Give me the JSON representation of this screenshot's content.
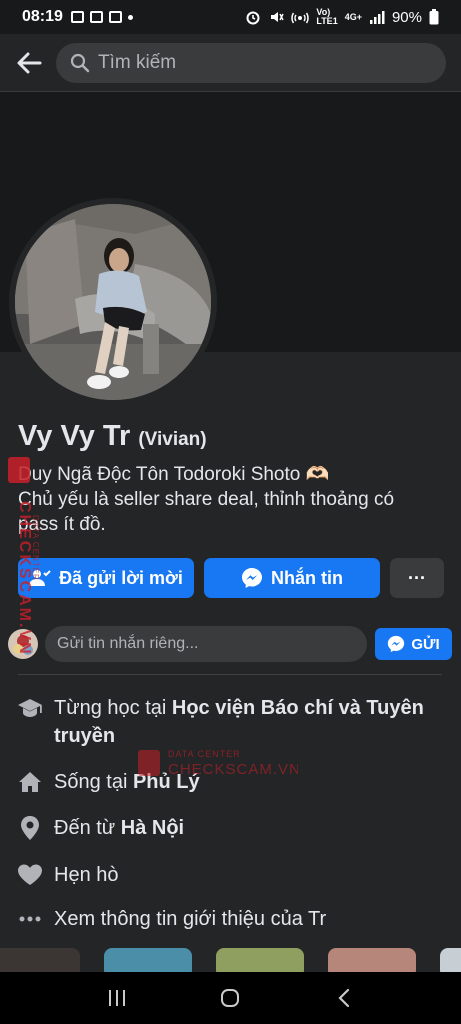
{
  "status": {
    "time": "08:19",
    "network": "4G+",
    "battery": "90%"
  },
  "search": {
    "placeholder": "Tìm kiếm"
  },
  "profile": {
    "name": "Vy Vy Tr",
    "alt_name": "(Vivian)",
    "bio_line1": "Duy Ngã Độc Tôn Todoroki Shoto 🫶🏻",
    "bio_line2": "Chủ yếu là seller share deal, thỉnh thoảng có",
    "bio_line3": "pass ít đồ."
  },
  "actions": {
    "friend_request_label": "Đã gửi lời mời",
    "message_label": "Nhắn tin",
    "more_label": "···"
  },
  "private_message": {
    "placeholder": "Gửi tin nhắn riêng...",
    "send_label": "GỬI"
  },
  "intro": [
    {
      "icon": "graduation-cap-icon",
      "prefix": "Từng học tại ",
      "bold": "Học viện Báo chí và Tuyên truyền"
    },
    {
      "icon": "home-icon",
      "prefix": "Sống tại ",
      "bold": "Phủ Lý"
    },
    {
      "icon": "location-pin-icon",
      "prefix": "Đến từ ",
      "bold": "Hà Nội"
    },
    {
      "icon": "heart-icon",
      "prefix": "Hẹn hò",
      "bold": ""
    },
    {
      "icon": "more-dots-icon",
      "prefix": "Xem thông tin giới thiệu của Tr",
      "bold": ""
    }
  ],
  "watermark": {
    "side_text": "CHECKSCAM.VN",
    "side_sub": "DATA CENTER",
    "center_top": "DATA CENTER",
    "center_main": "CHECKSCAM.VN"
  },
  "colors": {
    "accent": "#1877f2",
    "surface": "#242526",
    "background": "#18191a"
  }
}
